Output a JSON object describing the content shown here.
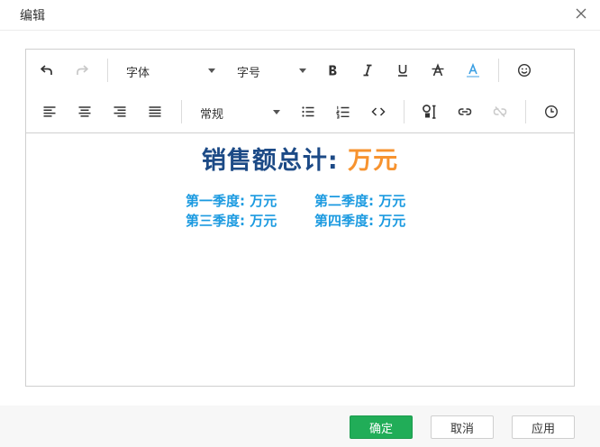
{
  "dialog": {
    "title": "编辑"
  },
  "toolbar": {
    "font_family": {
      "label": "字体"
    },
    "font_size": {
      "label": "字号"
    },
    "paragraph_style": {
      "label": "常规"
    },
    "icons": {
      "undo": "undo-icon",
      "redo": "redo-icon",
      "bold": "bold-icon",
      "italic": "italic-icon",
      "underline": "underline-icon",
      "strikethrough": "strikethrough-icon",
      "font_color": "font-color-icon",
      "emoji": "emoji-icon",
      "align_left": "align-left-icon",
      "align_center": "align-center-icon",
      "align_right": "align-right-icon",
      "justify": "justify-icon",
      "bullet_list": "bullet-list-icon",
      "numbered_list": "numbered-list-icon",
      "code": "code-icon",
      "insert_field": "insert-field-icon",
      "link": "link-icon",
      "unlink": "unlink-icon",
      "clock": "clock-icon"
    },
    "font_color_underline": "#4da8e8"
  },
  "content": {
    "headline_prefix": "销售额总计: ",
    "headline_value": "万元",
    "quarters": [
      {
        "label": "第一季度: 万元"
      },
      {
        "label": "第二季度: 万元"
      },
      {
        "label": "第三季度: 万元"
      },
      {
        "label": "第四季度: 万元"
      }
    ]
  },
  "colors": {
    "headline": "#1c4a86",
    "headline_accent": "#f7932f",
    "quarter_text": "#1b9ae0",
    "primary_button": "#21ad58"
  },
  "footer": {
    "confirm_label": "确定",
    "cancel_label": "取消",
    "apply_label": "应用"
  }
}
